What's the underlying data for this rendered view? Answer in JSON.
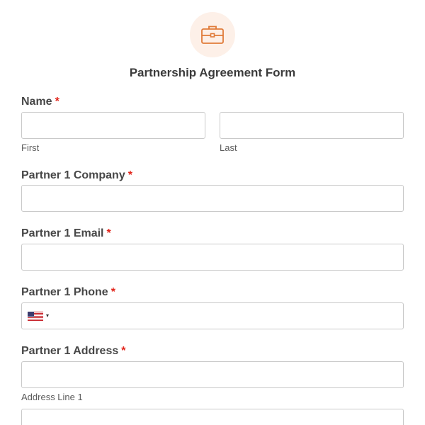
{
  "header": {
    "icon": "briefcase-icon",
    "title": "Partnership Agreement Form"
  },
  "colors": {
    "accent": "#e07b39",
    "required": "#e2261c",
    "icon_bg": "#fdf0e8"
  },
  "fields": {
    "name": {
      "label": "Name",
      "required_mark": "*",
      "first_sublabel": "First",
      "last_sublabel": "Last",
      "first_value": "",
      "last_value": ""
    },
    "company": {
      "label": "Partner 1 Company",
      "required_mark": "*",
      "value": ""
    },
    "email": {
      "label": "Partner 1 Email",
      "required_mark": "*",
      "value": ""
    },
    "phone": {
      "label": "Partner 1 Phone",
      "required_mark": "*",
      "country_flag": "us-flag-icon",
      "dropdown_caret": "▾",
      "value": ""
    },
    "address": {
      "label": "Partner 1 Address",
      "required_mark": "*",
      "line1_sublabel": "Address Line 1",
      "line1_value": "",
      "line2_value": ""
    }
  }
}
